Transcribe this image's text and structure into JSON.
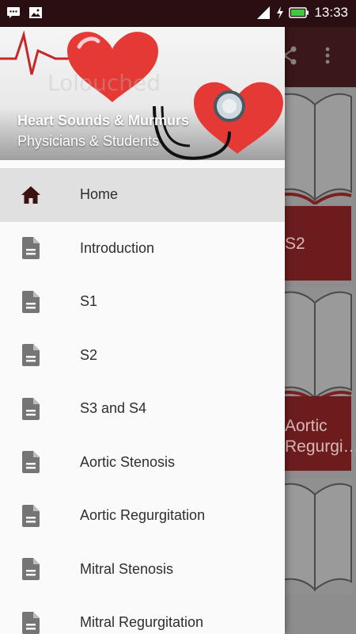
{
  "status_bar": {
    "time": "13:33",
    "left_icons": [
      "message-icon",
      "image-icon"
    ],
    "right_icons": [
      "signal-icon",
      "charging-icon",
      "battery-icon"
    ]
  },
  "drawer": {
    "header": {
      "title": "Heart Sounds & Murmurs",
      "subtitle": "Physicians & Students"
    },
    "items": [
      {
        "label": "Home",
        "icon": "home-icon",
        "active": true
      },
      {
        "label": "Introduction",
        "icon": "document-icon"
      },
      {
        "label": "S1",
        "icon": "document-icon"
      },
      {
        "label": "S2",
        "icon": "document-icon"
      },
      {
        "label": "S3 and S4",
        "icon": "document-icon"
      },
      {
        "label": "Aortic Stenosis",
        "icon": "document-icon"
      },
      {
        "label": "Aortic Regurgitation",
        "icon": "document-icon"
      },
      {
        "label": "Mitral Stenosis",
        "icon": "document-icon"
      },
      {
        "label": "Mitral Regurgitation",
        "icon": "document-icon"
      }
    ]
  },
  "background": {
    "toolbar_icons": [
      "share-icon",
      "more-vert-icon"
    ],
    "cards": [
      {
        "label_line1": "S2",
        "label_line2": ""
      },
      {
        "label_line1": "Aortic",
        "label_line2": "Regurgi…"
      }
    ]
  },
  "colors": {
    "status_bar": "#2a0f12",
    "toolbar": "#3a1718",
    "accent_red": "#6d1c1e",
    "active_item": "#e0e0e0",
    "icon_gray": "#757575",
    "home_icon": "#3a1212"
  }
}
